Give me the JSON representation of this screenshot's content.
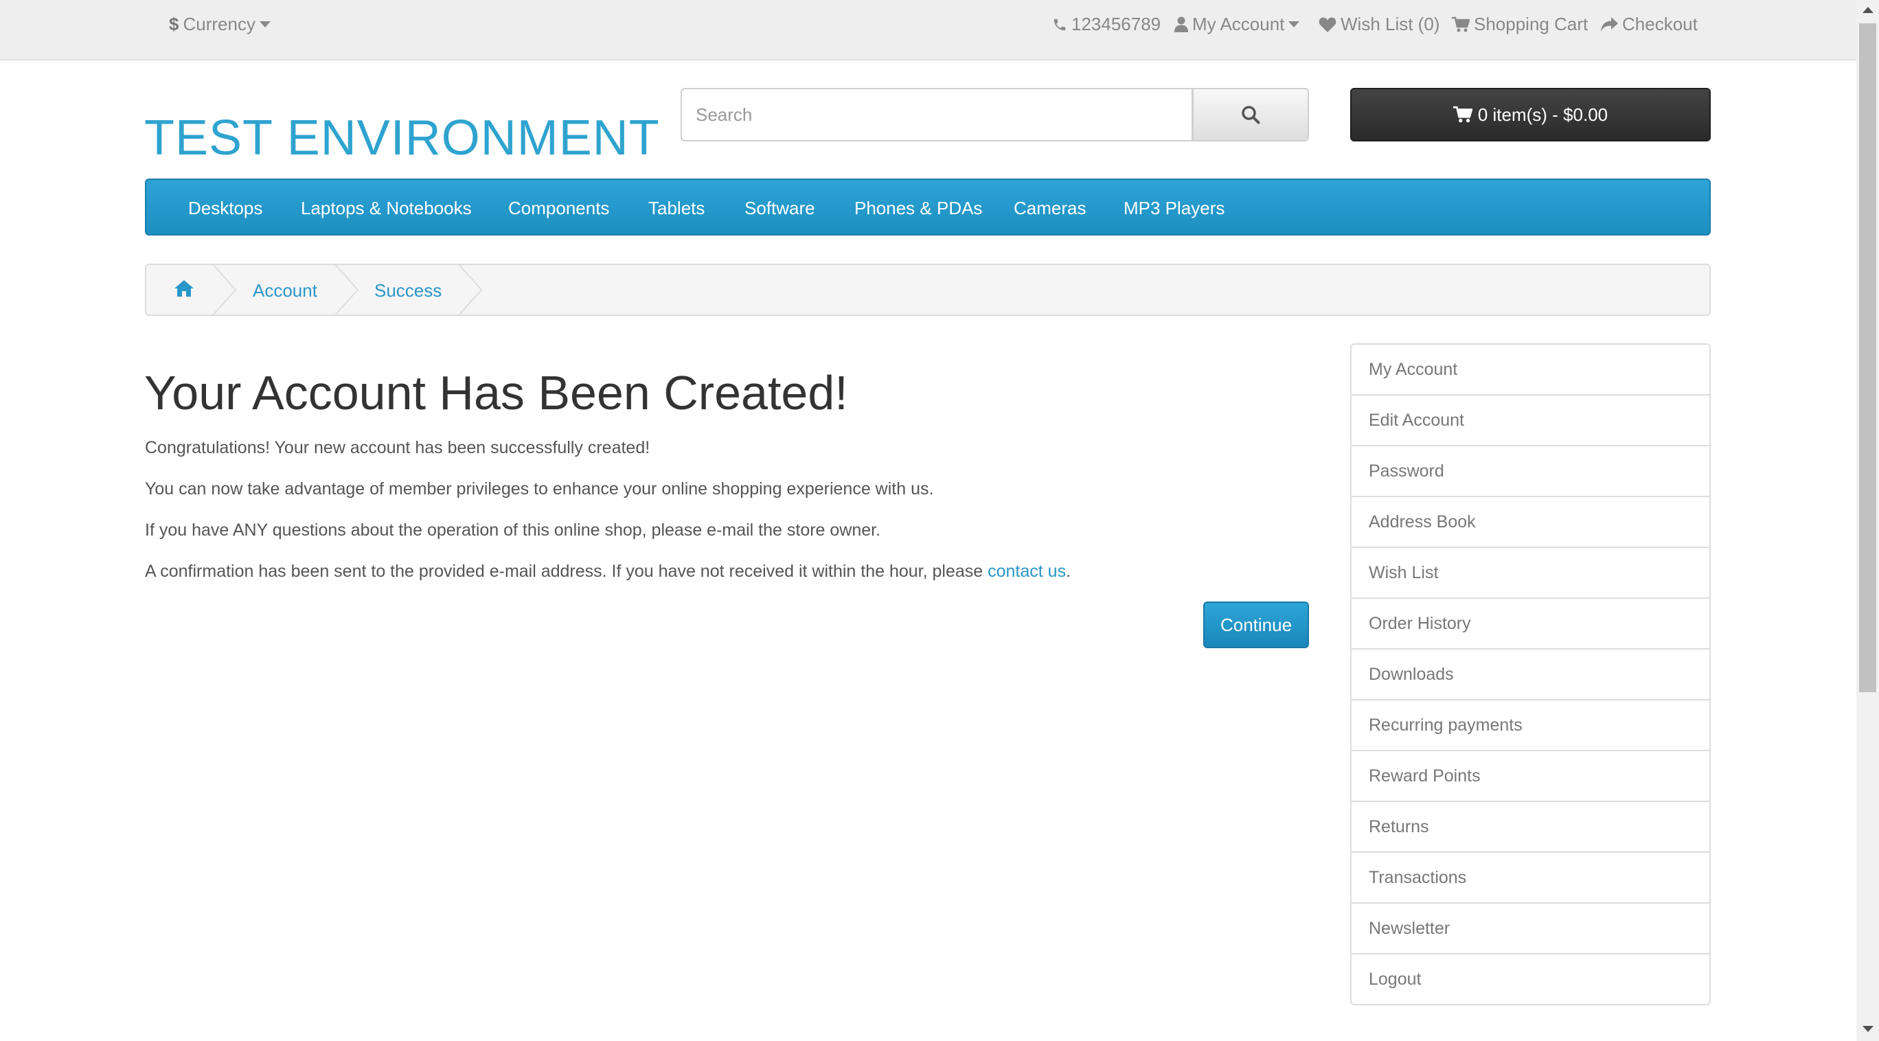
{
  "topbar": {
    "currency_symbol": "$",
    "currency_label": "Currency",
    "phone": "123456789",
    "my_account": "My Account",
    "wish_list": "Wish List (0)",
    "shopping_cart": "Shopping Cart",
    "checkout": "Checkout"
  },
  "header": {
    "logo": "TEST ENVIRONMENT",
    "search_placeholder": "Search",
    "cart_summary": "0 item(s) - $0.00"
  },
  "menu": [
    "Desktops",
    "Laptops & Notebooks",
    "Components",
    "Tablets",
    "Software",
    "Phones & PDAs",
    "Cameras",
    "MP3 Players"
  ],
  "breadcrumb": [
    "Account",
    "Success"
  ],
  "content": {
    "title": "Your Account Has Been Created!",
    "p1": "Congratulations! Your new account has been successfully created!",
    "p2": "You can now take advantage of member privileges to enhance your online shopping experience with us.",
    "p3": "If you have ANY questions about the operation of this online shop, please e-mail the store owner.",
    "p4_before": "A confirmation has been sent to the provided e-mail address. If you have not received it within the hour, please ",
    "p4_link": "contact us",
    "p4_after": ".",
    "continue": "Continue"
  },
  "account_menu": [
    "My Account",
    "Edit Account",
    "Password",
    "Address Book",
    "Wish List",
    "Order History",
    "Downloads",
    "Recurring payments",
    "Reward Points",
    "Returns",
    "Transactions",
    "Newsletter",
    "Logout"
  ],
  "colors": {
    "accent": "#2fa3cf",
    "menu": "#229ad0",
    "dark_button": "#363636"
  }
}
